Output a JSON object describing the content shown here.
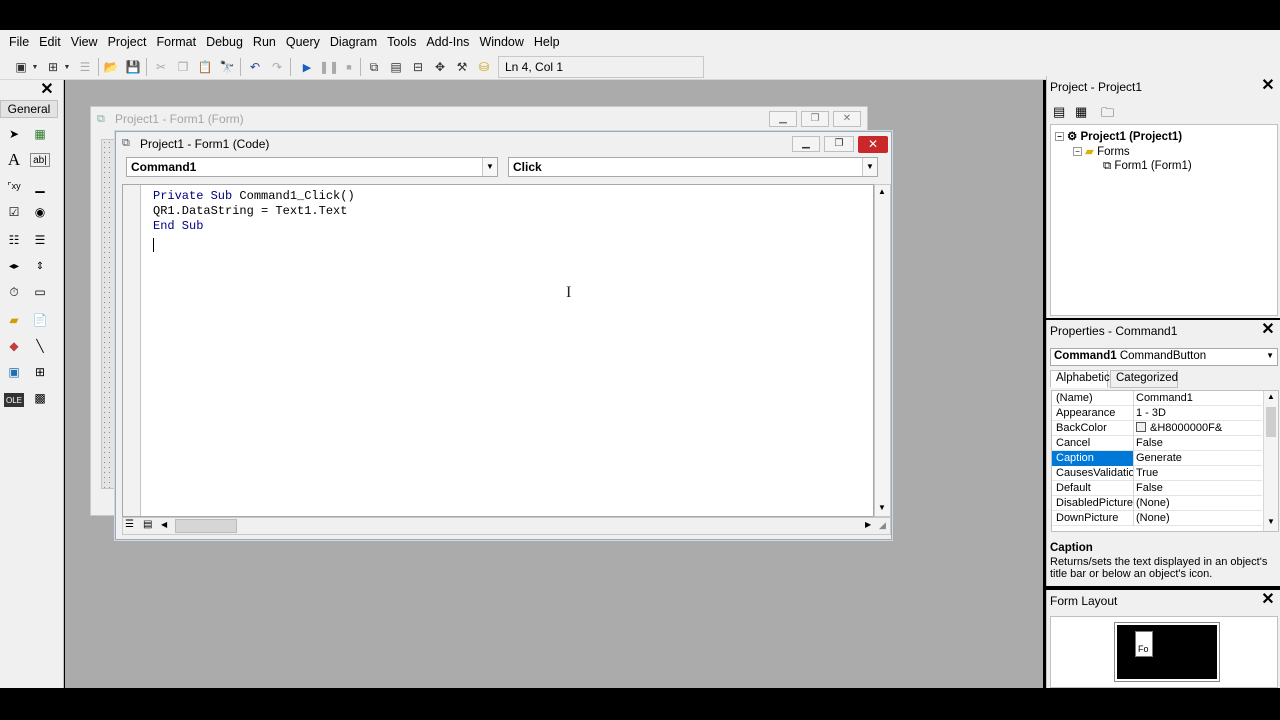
{
  "menu": [
    "File",
    "Edit",
    "View",
    "Project",
    "Format",
    "Debug",
    "Run",
    "Query",
    "Diagram",
    "Tools",
    "Add-Ins",
    "Window",
    "Help"
  ],
  "toolbar": {
    "position": "Ln 4, Col 1"
  },
  "toolbox": {
    "tab": "General",
    "close": "✕"
  },
  "form_window": {
    "title": "Project1 - Form1 (Form)"
  },
  "code_window": {
    "title": "Project1 - Form1 (Code)",
    "object": "Command1",
    "procedure": "Click",
    "lines": [
      {
        "kw": "Private Sub",
        "rest": " Command1_Click()"
      },
      {
        "kw": "",
        "rest": "QR1.DataString = Text1.Text"
      },
      {
        "kw": "End Sub",
        "rest": ""
      }
    ]
  },
  "project_panel": {
    "title": "Project - Project1",
    "tree": [
      {
        "label": "Project1 (Project1)"
      },
      {
        "label": "Forms"
      },
      {
        "label": "Form1 (Form1)"
      }
    ]
  },
  "properties_panel": {
    "title": "Properties - Command1",
    "object_name": "Command1",
    "object_type": "CommandButton",
    "tabs": [
      "Alphabetic",
      "Categorized"
    ],
    "rows": [
      {
        "name": "(Name)",
        "value": "Command1"
      },
      {
        "name": "Appearance",
        "value": "1 - 3D"
      },
      {
        "name": "BackColor",
        "value": "&H8000000F&"
      },
      {
        "name": "Cancel",
        "value": "False"
      },
      {
        "name": "Caption",
        "value": "Generate"
      },
      {
        "name": "CausesValidation",
        "value": "True"
      },
      {
        "name": "Default",
        "value": "False"
      },
      {
        "name": "DisabledPicture",
        "value": "(None)"
      },
      {
        "name": "DownPicture",
        "value": "(None)"
      }
    ],
    "selected_row": "Caption",
    "description_title": "Caption",
    "description_text": "Returns/sets the text displayed in an object's title bar or below an object's icon."
  },
  "layout_panel": {
    "title": "Form Layout",
    "form_label": "Fo"
  },
  "colors": {
    "selection": "#0078d7",
    "keyword": "#00007f",
    "close_button": "#c8282a",
    "mdi_background": "#ababab"
  }
}
